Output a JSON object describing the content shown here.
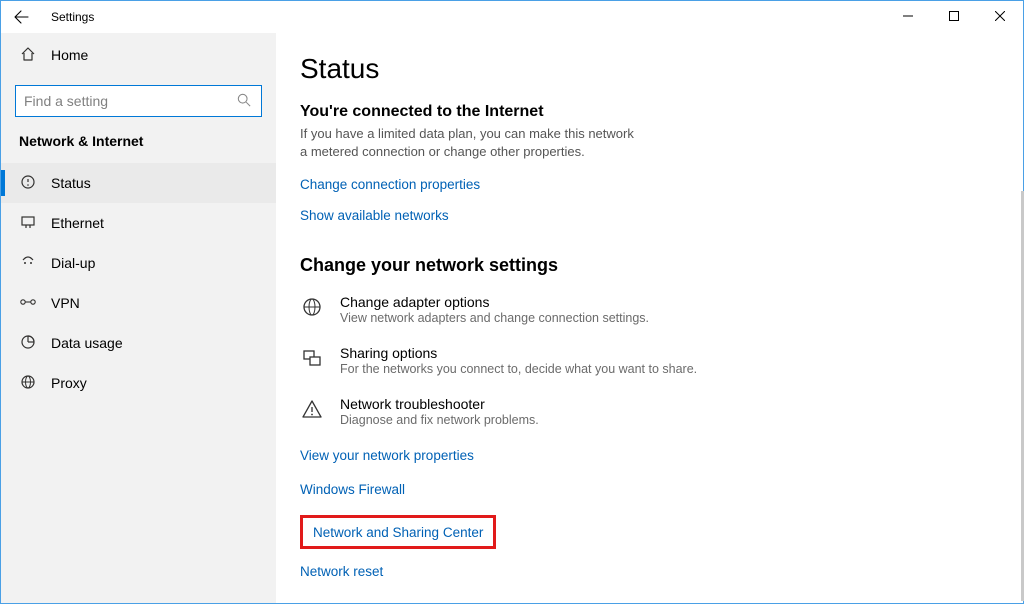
{
  "window": {
    "title": "Settings"
  },
  "sidebar": {
    "home": "Home",
    "search_placeholder": "Find a setting",
    "category": "Network & Internet",
    "items": [
      {
        "label": "Status",
        "selected": true
      },
      {
        "label": "Ethernet",
        "selected": false
      },
      {
        "label": "Dial-up",
        "selected": false
      },
      {
        "label": "VPN",
        "selected": false
      },
      {
        "label": "Data usage",
        "selected": false
      },
      {
        "label": "Proxy",
        "selected": false
      }
    ]
  },
  "page": {
    "title": "Status",
    "connected_head": "You're connected to the Internet",
    "connected_desc": "If you have a limited data plan, you can make this network a metered connection or change other properties.",
    "link_change_conn": "Change connection properties",
    "link_show_avail": "Show available networks",
    "sechead": "Change your network settings",
    "options": [
      {
        "title": "Change adapter options",
        "desc": "View network adapters and change connection settings."
      },
      {
        "title": "Sharing options",
        "desc": "For the networks you connect to, decide what you want to share."
      },
      {
        "title": "Network troubleshooter",
        "desc": "Diagnose and fix network problems."
      }
    ],
    "links": {
      "view_props": "View your network properties",
      "firewall": "Windows Firewall",
      "sharing_ctr": "Network and Sharing Center",
      "reset": "Network reset"
    }
  }
}
